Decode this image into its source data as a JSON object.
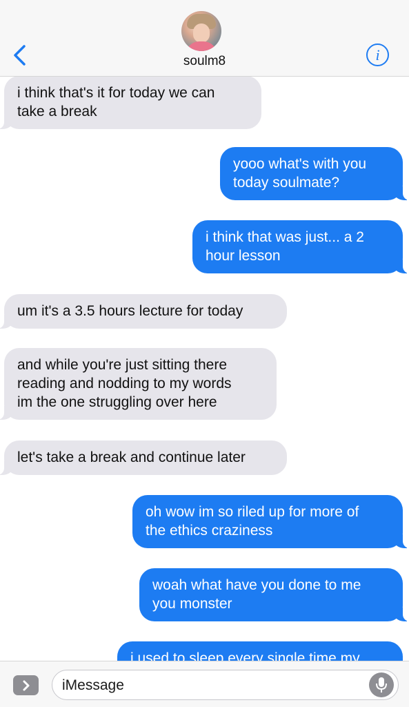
{
  "header": {
    "contact_name": "soulm8",
    "back_icon": "chevron-left-icon",
    "info_icon": "info-icon",
    "accent_color": "#1d7cf2"
  },
  "messages": [
    {
      "direction": "incoming",
      "text": "i think that's it for today we can\ntake a break"
    },
    {
      "direction": "outgoing",
      "text": "yooo what's with you\ntoday soulmate?"
    },
    {
      "direction": "outgoing",
      "text": "i think that was just... a 2\nhour lesson"
    },
    {
      "direction": "incoming",
      "text": "um it's a 3.5 hours lecture for today"
    },
    {
      "direction": "incoming",
      "text": "and while you're just sitting there\nreading and nodding to my words\nim the one struggling over here"
    },
    {
      "direction": "incoming",
      "text": "let's take a break and continue later"
    },
    {
      "direction": "outgoing",
      "text": "oh wow im so riled up for more of\nthe ethics craziness"
    },
    {
      "direction": "outgoing",
      "text": "woah what have you done to me\nyou monster"
    },
    {
      "direction": "outgoing",
      "text": "i used to sleep every single time my"
    }
  ],
  "composer": {
    "placeholder": "iMessage",
    "apps_icon": "chevron-right-icon",
    "mic_icon": "microphone-icon"
  }
}
